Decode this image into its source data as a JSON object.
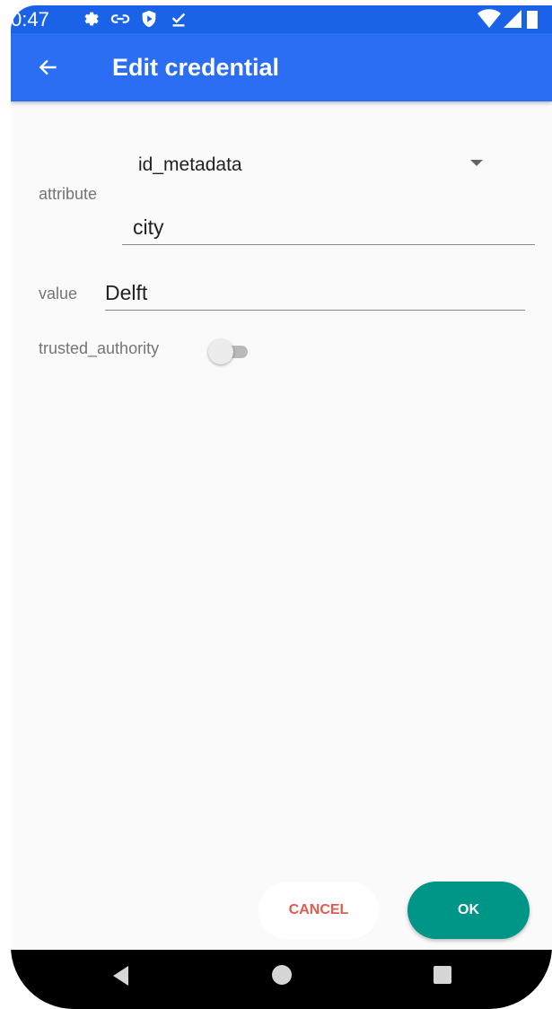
{
  "status_bar": {
    "time": "0:47",
    "icons": [
      "settings-icon",
      "link-icon",
      "shield-icon",
      "download-done-icon",
      "wifi-icon",
      "signal-icon",
      "battery-icon"
    ]
  },
  "app_bar": {
    "back_icon": "arrow-back-icon",
    "title": "Edit credential",
    "color": "#2b6df3"
  },
  "form": {
    "dropdown": {
      "selected": "id_metadata",
      "icon": "dropdown-arrow-icon"
    },
    "attribute": {
      "label": "attribute",
      "value": "city"
    },
    "value": {
      "label": "value",
      "value": "Delft"
    },
    "trusted_authority": {
      "label": "trusted_authority",
      "checked": false
    }
  },
  "actions": {
    "cancel_label": "CANCEL",
    "ok_label": "OK",
    "cancel_color": "#e45a4d",
    "ok_color": "#009687"
  },
  "nav_bar": {
    "icons": [
      "nav-back-icon",
      "nav-home-icon",
      "nav-recents-icon"
    ]
  }
}
